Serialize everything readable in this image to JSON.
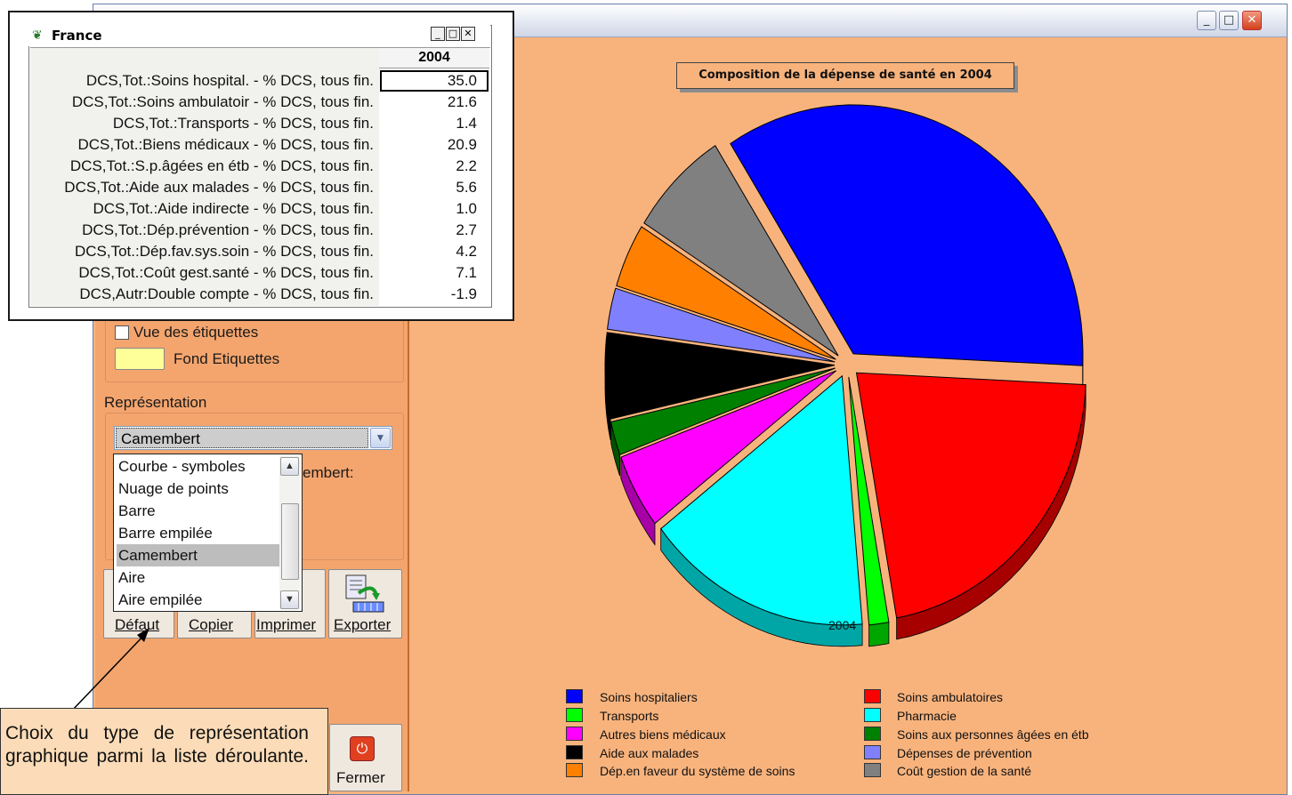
{
  "window": {
    "controls": [
      "minimize-icon",
      "maximize-icon",
      "close-icon"
    ],
    "accent": "#f8b37d"
  },
  "data_window": {
    "title": "France",
    "column_header": "2004",
    "rows": [
      {
        "label": "DCS,Tot.:Soins hospital. - % DCS, tous fin.",
        "value": "35.0"
      },
      {
        "label": "DCS,Tot.:Soins ambulatoir - % DCS, tous fin.",
        "value": "21.6"
      },
      {
        "label": "DCS,Tot.:Transports - % DCS, tous fin.",
        "value": "1.4"
      },
      {
        "label": "DCS,Tot.:Biens médicaux - % DCS, tous fin.",
        "value": "20.9"
      },
      {
        "label": "DCS,Tot.:S.p.âgées en étb - % DCS, tous fin.",
        "value": "2.2"
      },
      {
        "label": "DCS,Tot.:Aide aux malades - % DCS, tous fin.",
        "value": "5.6"
      },
      {
        "label": "DCS,Tot.:Aide indirecte - % DCS, tous fin.",
        "value": "1.0"
      },
      {
        "label": "DCS,Tot.:Dép.prévention - % DCS, tous fin.",
        "value": "2.7"
      },
      {
        "label": "DCS,Tot.:Dép.fav.sys.soin - % DCS, tous fin.",
        "value": "4.2"
      },
      {
        "label": "DCS,Tot.:Coût gest.santé - % DCS, tous fin.",
        "value": "7.1"
      },
      {
        "label": "DCS,Autr:Double compte - % DCS, tous fin.",
        "value": "-1.9"
      }
    ]
  },
  "left_panel": {
    "labels_checkbox": "Vue des étiquettes",
    "labels_checked": false,
    "background_swatch_label": "Fond Etiquettes",
    "background_swatch_color": "#ffff99",
    "representation_title": "Représentation",
    "representation_selected": "Camembert",
    "partial_label": "embert:",
    "dropdown_options": [
      "Courbe - symboles",
      "Nuage de points",
      "Barre",
      "Barre empilée",
      "Camembert",
      "Aire",
      "Aire empilée"
    ],
    "buttons": {
      "defaut": "Défaut",
      "copier": "Copier",
      "imprimer": "Imprimer",
      "exporter": "Exporter",
      "fermer": "Fermer"
    }
  },
  "chart_data": {
    "type": "pie",
    "title": "Composition de la dépense de santé en 2004",
    "xlabel": "2004",
    "legend_position": "bottom",
    "slices": [
      {
        "name": "Soins hospitaliers",
        "value": 35.0,
        "color": "#0000ff"
      },
      {
        "name": "Soins ambulatoires",
        "value": 21.6,
        "color": "#ff0000"
      },
      {
        "name": "Transports",
        "value": 1.4,
        "color": "#00ff00"
      },
      {
        "name": "Pharmacie",
        "value": 16.0,
        "color": "#00ffff"
      },
      {
        "name": "Autres biens médicaux",
        "value": 4.9,
        "color": "#ff00ff"
      },
      {
        "name": "Soins aux personnes âgées en étb",
        "value": 2.2,
        "color": "#008000"
      },
      {
        "name": "Aide aux malades",
        "value": 5.6,
        "color": "#000000"
      },
      {
        "name": "Dépenses de prévention",
        "value": 2.7,
        "color": "#8080ff"
      },
      {
        "name": "Dép.en faveur du système de soins",
        "value": 4.2,
        "color": "#ff8000"
      },
      {
        "name": "Coût gestion de la santé",
        "value": 7.1,
        "color": "#808080"
      }
    ]
  },
  "annotation": {
    "text": "Choix du type de représentation graphique parmi la liste déroulante."
  }
}
